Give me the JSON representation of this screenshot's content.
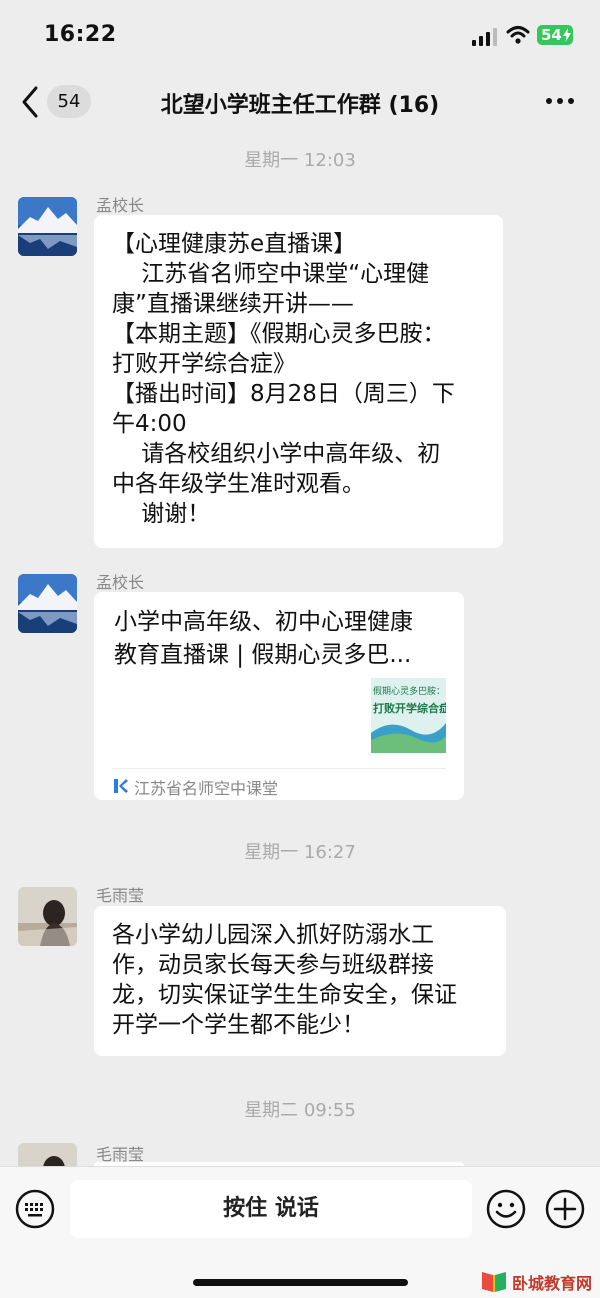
{
  "status_bar": {
    "time": "16:22",
    "battery": "54"
  },
  "nav": {
    "unread_count": "54",
    "title": "北望小学班主任工作群 (16)"
  },
  "messages": [
    {
      "type": "time",
      "text": "星期一 12:03"
    },
    {
      "type": "text",
      "sender": "孟校长",
      "avatar": "mountain-lake-avatar",
      "text": "【心理健康苏 e 直播课】\n    江苏省名师空中课堂“心理健康”直播课继续开讲——\n【本期主题】《假期心灵多巴胺：打败开学综合症》\n【播出时间】8月28日（周三）下午4:00\n    请各校组织小学中高年级、初中各年级学生准时观看。\n    谢谢！",
      "lines": [
        "【心理健康苏e直播课】",
        "    江苏省名师空中课堂“心理健",
        "康”直播课继续开讲——",
        "【本期主题】《假期心灵多巴胺：",
        "打败开学综合症》",
        "【播出时间】8月28日（周三）下",
        "午4:00",
        "    请各校组织小学中高年级、初",
        "中各年级学生准时观看。",
        "    谢谢！"
      ]
    },
    {
      "type": "link-card",
      "sender": "孟校长",
      "avatar": "mountain-lake-avatar",
      "card_title_lines": [
        "小学中高年级、初中心理健康",
        "教育直播课 | 假期心灵多巴..."
      ],
      "thumb_text": "打败开学综合症",
      "thumb_text_top": "假期心灵多巴胺：",
      "source": "江苏省名师空中课堂"
    },
    {
      "type": "time",
      "text": "星期一 16:27"
    },
    {
      "type": "text",
      "sender": "毛雨莹",
      "avatar": "person-avatar",
      "lines": [
        "各小学幼儿园深入抓好防溺水工",
        "作，动员家长每天参与班级群接",
        "龙，切实保证学生生命安全，保证",
        "开学一个学生都不能少！"
      ]
    },
    {
      "type": "time",
      "text": "星期二 09:55"
    },
    {
      "type": "text",
      "sender": "毛雨莹",
      "avatar": "person-avatar",
      "lines": []
    }
  ],
  "input_bar": {
    "voice_label": "按住 说话"
  },
  "watermark": {
    "text": "卧城教育网"
  },
  "colors": {
    "background": "#ededed",
    "bubble": "#ffffff",
    "battery": "#34c759",
    "card_thumb": "#3aa0c8"
  }
}
